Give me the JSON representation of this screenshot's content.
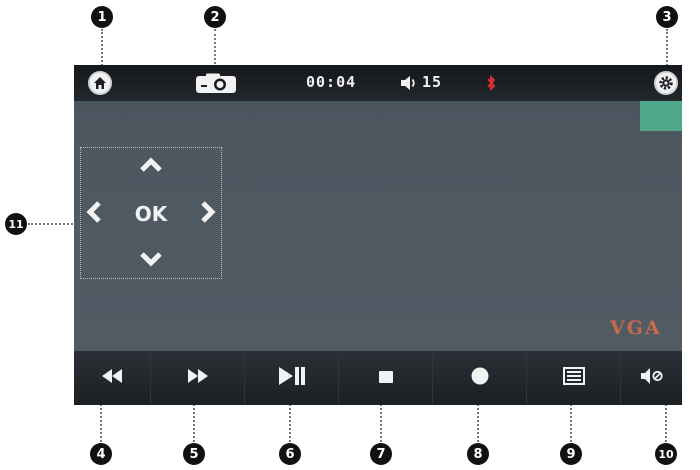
{
  "callouts": [
    "1",
    "2",
    "3",
    "4",
    "5",
    "6",
    "7",
    "8",
    "9",
    "10",
    "11"
  ],
  "status_bar": {
    "home_icon": "home-icon",
    "camera_icon": "camera-icon",
    "time": "00:04",
    "volume_icon": "volume-icon",
    "volume": "15",
    "bluetooth_icon": "bluetooth-icon",
    "settings_icon": "gear-icon"
  },
  "dpad": {
    "ok_label": "OK",
    "up_icon": "chevron-up-icon",
    "down_icon": "chevron-down-icon",
    "left_icon": "chevron-left-icon",
    "right_icon": "chevron-right-icon"
  },
  "overlay": {
    "resolution": "VGA"
  },
  "controls": [
    {
      "name": "rewind",
      "icon": "rewind-icon"
    },
    {
      "name": "fast-forward",
      "icon": "fast-forward-icon"
    },
    {
      "name": "play-pause",
      "icon": "play-pause-icon"
    },
    {
      "name": "stop",
      "icon": "stop-icon"
    },
    {
      "name": "record",
      "icon": "record-icon"
    },
    {
      "name": "menu",
      "icon": "list-icon"
    },
    {
      "name": "mute",
      "icon": "mute-icon"
    }
  ],
  "colors": {
    "screen_bg": "#4f5962",
    "bar_bg": "#1e2226",
    "icon": "#f2f2f2",
    "bluetooth": "#e03030",
    "vga_text": "#c96a4d",
    "callout": "#111111"
  }
}
